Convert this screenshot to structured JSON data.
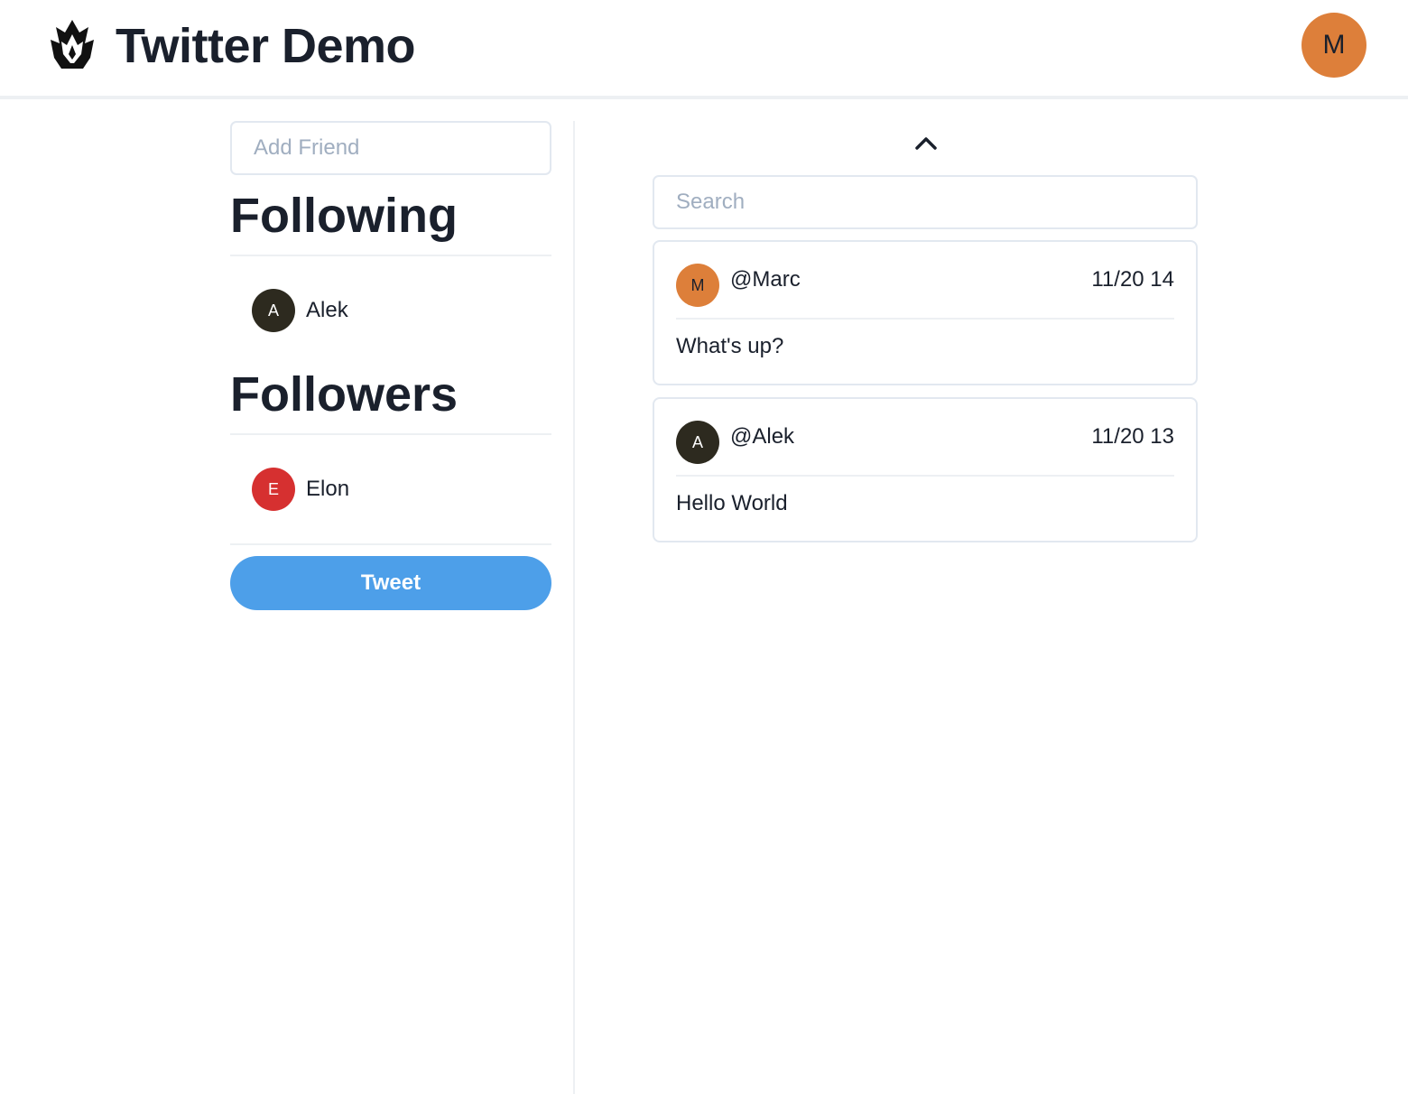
{
  "header": {
    "title": "Twitter Demo",
    "user_initial": "M",
    "user_color": "#dd7f3a",
    "logo_icon": "flame-logo-icon"
  },
  "sidebar": {
    "add_friend_placeholder": "Add Friend",
    "following_title": "Following",
    "following": [
      {
        "initial": "A",
        "name": "Alek",
        "color": "#2d2a1f"
      }
    ],
    "followers_title": "Followers",
    "followers": [
      {
        "initial": "E",
        "name": "Elon",
        "color": "#d63030"
      }
    ],
    "tweet_label": "Tweet",
    "tweet_color": "#4d9fe9"
  },
  "feed": {
    "collapse_icon": "chevron-up-icon",
    "search_placeholder": "Search",
    "tweets": [
      {
        "initial": "M",
        "handle": "@Marc",
        "time": "11/20 14",
        "text": "What's up?",
        "color": "#dd7f3a"
      },
      {
        "initial": "A",
        "handle": "@Alek",
        "time": "11/20 13",
        "text": "Hello World",
        "color": "#2d2a1f"
      }
    ]
  }
}
